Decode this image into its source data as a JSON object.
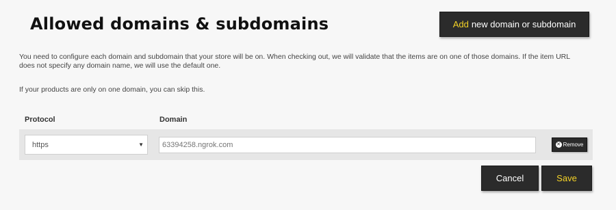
{
  "header": {
    "title": "Allowed domains & subdomains",
    "add_button": {
      "accent": "Add",
      "label": "new domain or subdomain"
    }
  },
  "description": {
    "intro": "You need to configure each domain and subdomain that your store will be on. When checking out, we will validate that the items are on one of those domains. If the item URL does not specify any domain name, we will use the default one.",
    "hint": "If your products are only on one domain, you can skip this."
  },
  "table": {
    "columns": [
      "Protocol",
      "Domain"
    ],
    "rows": [
      {
        "protocol": "https",
        "domain_placeholder": "63394258.ngrok.com",
        "remove_label": "Remove"
      }
    ]
  },
  "actions": {
    "cancel": "Cancel",
    "save": "Save"
  },
  "colors": {
    "accent": "#f5d327",
    "button_bg": "#2b2b2b",
    "row_bg": "#e6e6e6",
    "page_bg": "#f7f7f7"
  }
}
